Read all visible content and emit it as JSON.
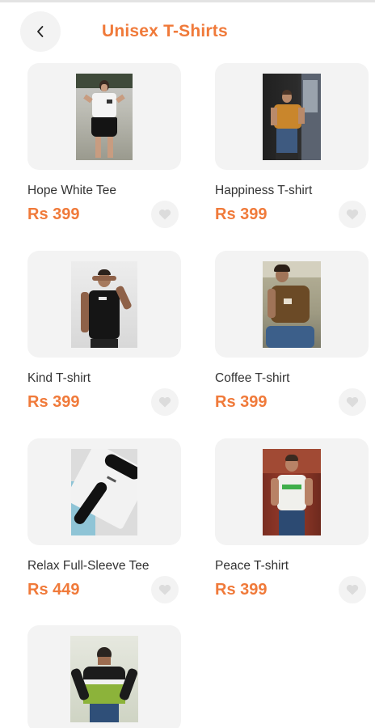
{
  "header": {
    "title": "Unisex T-Shirts",
    "back_icon": "chevron-left-icon"
  },
  "colors": {
    "accent": "#f07a3a",
    "card_bg": "#f3f3f3",
    "text": "#333333"
  },
  "products": [
    {
      "name": "Hope White Tee",
      "price": "Rs 399",
      "image": "model-white-tee-photo"
    },
    {
      "name": "Happiness T-shirt",
      "price": "Rs 399",
      "image": "model-mustard-tee-photo"
    },
    {
      "name": "Kind T-shirt",
      "price": "Rs 399",
      "image": "model-black-tee-photo"
    },
    {
      "name": "Coffee T-shirt",
      "price": "Rs 399",
      "image": "model-brown-tee-photo"
    },
    {
      "name": "Relax Full-Sleeve Tee",
      "price": "Rs 449",
      "image": "full-sleeve-tee-photo"
    },
    {
      "name": "Peace T-shirt",
      "price": "Rs 399",
      "image": "model-peace-tee-photo"
    },
    {
      "name": "",
      "price": "",
      "image": "model-green-striped-tee-photo"
    }
  ],
  "favorite_icon": "heart-icon"
}
